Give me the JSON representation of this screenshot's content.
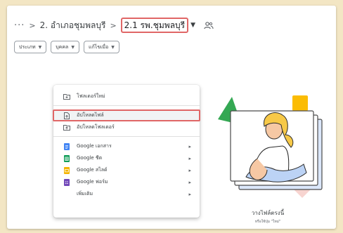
{
  "breadcrumb": {
    "more": "···",
    "sep": ">",
    "items": [
      "2. อำเภอชุมพลบุรี",
      "2.1 รพ.ชุมพลบุรี"
    ]
  },
  "filters": [
    {
      "label": "ประเภท"
    },
    {
      "label": "บุคคล"
    },
    {
      "label": "แก้ไขเมื่อ"
    }
  ],
  "menu": {
    "items": [
      {
        "label": "โฟลเดอร์ใหม่",
        "icon": "new-folder-icon"
      },
      {
        "label": "อัปโหลดไฟล์",
        "icon": "file-upload-icon",
        "highlight": true
      },
      {
        "label": "อัปโหลดโฟลเดอร์",
        "icon": "folder-upload-icon"
      },
      {
        "label": "Google เอกสาร",
        "icon": "google-docs-icon",
        "color": "#4285f4"
      },
      {
        "label": "Google ชีต",
        "icon": "google-sheets-icon",
        "color": "#0f9d58"
      },
      {
        "label": "Google สไลด์",
        "icon": "google-slides-icon",
        "color": "#f4b400"
      },
      {
        "label": "Google ฟอร์ม",
        "icon": "google-forms-icon",
        "color": "#7248b9"
      },
      {
        "label": "เพิ่มเติม",
        "icon": "blank-icon"
      }
    ]
  },
  "empty_state": {
    "title": "วางไฟล์ตรงนี้",
    "subtitle": "หรือใช้ปุ่ม \"ใหม่\""
  },
  "colors": {
    "highlight": "#e06666",
    "green_shape": "#34a853",
    "yellow_shape": "#fbbc04",
    "pink_shape": "#f7d4d0",
    "background": "#f3e6c4"
  }
}
